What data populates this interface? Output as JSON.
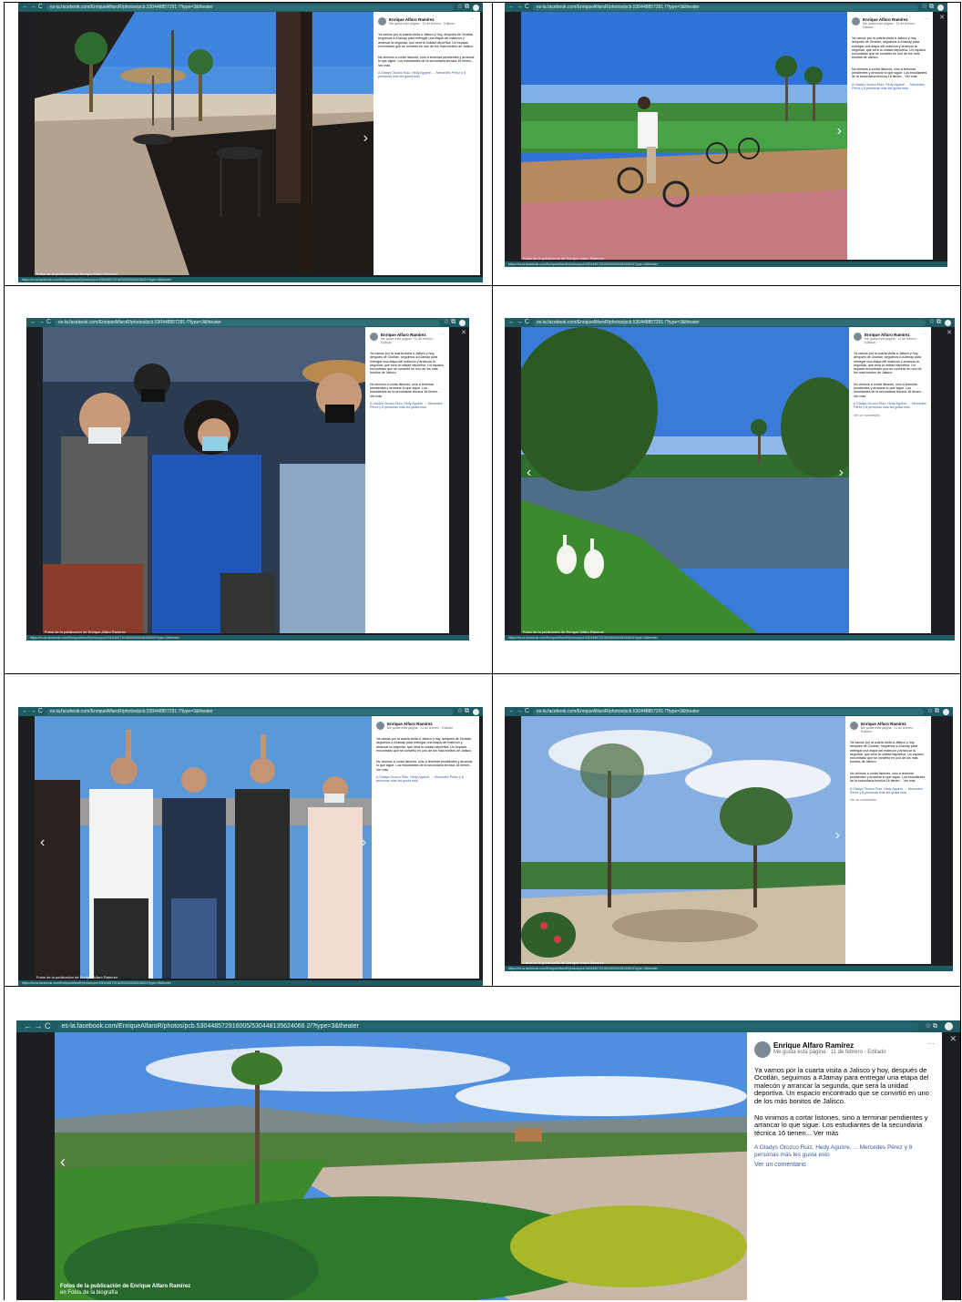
{
  "browser": {
    "nav_glyphs": "← → C",
    "ext_glyphs": "☆ ⧉",
    "url_small": "es-la.facebook.com/EnriqueAlfaroR/photos/pcb.530448857291 /?type=3&theater",
    "url_big": "es-la.facebook.com/EnriqueAlfaroR/photos/pcb.530448572916005/530448135624066 2/?type=3&theater",
    "status_small": "https://es-la.facebook.com/EnriqueAlfaroR/photos/pcb.530448572916005/530448135624?type=3&theater"
  },
  "post": {
    "author": "Enrique Alfaro Ramírez",
    "meta": "Me gusta esta página · 11 de febrero · Editado ·",
    "more": "···",
    "body": "Ya vamos por la cuarta visita a Jalisco y hoy, después de Ocotlán, seguimos a #Jamay para entregar una etapa del malecón y arrancar la segunda, que será la unidad deportiva. Un espacio encontrado que se convirtió en uno de los más bonitos de Jalisco.",
    "body2": "No vinimos a cortar listones, sino a terminar pendientes y arrancar lo que sigue. Los estudiantes de la secundaria técnica 16 tienen... Ver más",
    "tags": "A Gladys Orozco Ruiz, Hedy Aguirre, ... Mercedes Pérez y 8 personas más les gusta esto",
    "comments": "Ver un comentario"
  },
  "caption": {
    "line1": "Fotos de la publicación de Enrique Alfaro Ramírez",
    "line2": "en Fotos de la biografía"
  },
  "icons": {
    "close": "✕",
    "prev": "‹",
    "next": "›"
  }
}
